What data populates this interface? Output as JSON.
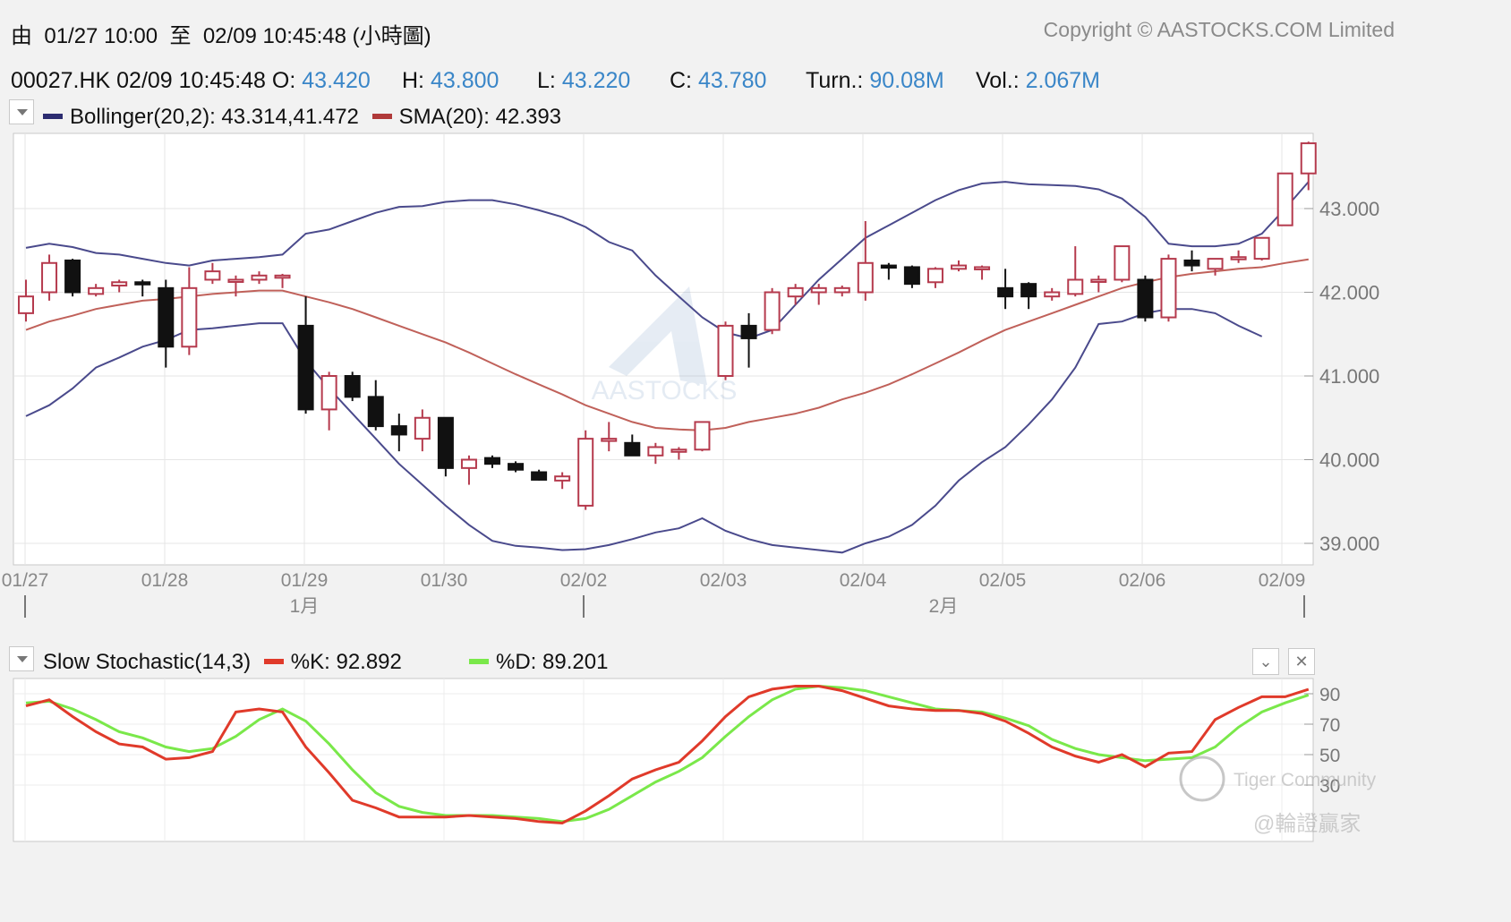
{
  "header": {
    "from_label": "由",
    "from_date": "01/27 10:00",
    "to_label": "至",
    "to_date": "02/09 10:45:48",
    "interval": "(小時圖)",
    "copyright": "Copyright © AASTOCKS.COM Limited"
  },
  "quote": {
    "symbol_time": "00027.HK  02/09 10:45:48",
    "open_label": "O:",
    "open": "43.420",
    "high_label": "H:",
    "high": "43.800",
    "low_label": "L:",
    "low": "43.220",
    "close_label": "C:",
    "close": "43.780",
    "turn_label": "Turn.:",
    "turn": "90.08M",
    "vol_label": "Vol.:",
    "vol": "2.067M"
  },
  "legend": {
    "bollinger": "Bollinger(20,2): 43.314,41.472",
    "sma": "SMA(20): 42.393",
    "stoch": "Slow Stochastic(14,3)",
    "k": "%K: 92.892",
    "d": "%D: 89.201"
  },
  "watermarks": {
    "aastocks": "AASTOCKS",
    "tiger": "Tiger Community",
    "wlwj": "@輪證贏家"
  },
  "colors": {
    "bollinger": "#4a4a8c",
    "sma": "#c0615a",
    "up_candle": "#b53a4d",
    "down_candle": "#111111",
    "stoch_k": "#e03a2a",
    "stoch_d": "#7ae84a",
    "value_blue": "#3a86c8"
  },
  "chart_data": [
    {
      "type": "candlestick",
      "title": "00027.HK",
      "y_ticks": [
        "39.000",
        "40.000",
        "41.000",
        "42.000",
        "43.000"
      ],
      "ylim": [
        38.75,
        43.95
      ],
      "x_ticks": [
        "01/27",
        "01/28",
        "01/29",
        "01/30",
        "02/02",
        "02/03",
        "02/04",
        "02/05",
        "02/06",
        "02/09"
      ],
      "month_labels": [
        {
          "label": "1月",
          "at": "01/29"
        },
        {
          "label": "2月",
          "at": "02/04"
        }
      ],
      "bars_per_day": 6,
      "ohlc": [
        [
          41.75,
          42.15,
          41.65,
          41.95
        ],
        [
          42.0,
          42.45,
          41.9,
          42.35
        ],
        [
          42.38,
          42.4,
          41.95,
          42.0
        ],
        [
          41.98,
          42.1,
          41.95,
          42.05
        ],
        [
          42.08,
          42.15,
          42.0,
          42.12
        ],
        [
          42.12,
          42.15,
          41.95,
          42.1
        ],
        [
          42.05,
          42.15,
          41.1,
          41.35
        ],
        [
          41.35,
          42.3,
          41.25,
          42.05
        ],
        [
          42.15,
          42.35,
          42.1,
          42.25
        ],
        [
          42.15,
          42.2,
          41.95,
          42.15
        ],
        [
          42.15,
          42.25,
          42.1,
          42.2
        ],
        [
          42.18,
          42.22,
          42.05,
          42.2
        ],
        [
          41.6,
          41.95,
          40.55,
          40.6
        ],
        [
          40.6,
          41.05,
          40.35,
          41.0
        ],
        [
          41.0,
          41.05,
          40.7,
          40.75
        ],
        [
          40.75,
          40.95,
          40.35,
          40.4
        ],
        [
          40.4,
          40.55,
          40.1,
          40.3
        ],
        [
          40.25,
          40.6,
          40.1,
          40.5
        ],
        [
          40.5,
          40.5,
          39.8,
          39.9
        ],
        [
          39.9,
          40.05,
          39.7,
          40.0
        ],
        [
          40.02,
          40.05,
          39.9,
          39.95
        ],
        [
          39.95,
          39.98,
          39.85,
          39.88
        ],
        [
          39.85,
          39.88,
          39.75,
          39.76
        ],
        [
          39.75,
          39.85,
          39.65,
          39.8
        ],
        [
          39.45,
          40.35,
          39.4,
          40.25
        ],
        [
          40.25,
          40.45,
          40.1,
          40.25
        ],
        [
          40.2,
          40.3,
          40.05,
          40.05
        ],
        [
          40.05,
          40.2,
          39.95,
          40.15
        ],
        [
          40.1,
          40.15,
          40.0,
          40.12
        ],
        [
          40.12,
          40.45,
          40.1,
          40.45
        ],
        [
          41.0,
          41.65,
          40.95,
          41.6
        ],
        [
          41.6,
          41.75,
          41.1,
          41.45
        ],
        [
          41.55,
          42.05,
          41.5,
          42.0
        ],
        [
          41.95,
          42.1,
          41.85,
          42.05
        ],
        [
          42.0,
          42.1,
          41.85,
          42.05
        ],
        [
          42.0,
          42.08,
          41.95,
          42.05
        ],
        [
          42.0,
          42.85,
          41.9,
          42.35
        ],
        [
          42.32,
          42.35,
          42.15,
          42.3
        ],
        [
          42.3,
          42.32,
          42.05,
          42.1
        ],
        [
          42.12,
          42.3,
          42.05,
          42.28
        ],
        [
          42.28,
          42.38,
          42.25,
          42.32
        ],
        [
          42.3,
          42.32,
          42.15,
          42.3
        ],
        [
          42.05,
          42.28,
          41.8,
          41.95
        ],
        [
          42.1,
          42.12,
          41.8,
          41.95
        ],
        [
          41.95,
          42.05,
          41.9,
          42.0
        ],
        [
          41.98,
          42.55,
          41.95,
          42.15
        ],
        [
          42.15,
          42.2,
          42.0,
          42.15
        ],
        [
          42.15,
          42.55,
          42.12,
          42.55
        ],
        [
          42.15,
          42.2,
          41.65,
          41.7
        ],
        [
          41.7,
          42.45,
          41.65,
          42.4
        ],
        [
          42.38,
          42.5,
          42.25,
          42.32
        ],
        [
          42.28,
          42.4,
          42.2,
          42.4
        ],
        [
          42.4,
          42.5,
          42.35,
          42.42
        ],
        [
          42.4,
          42.65,
          42.38,
          42.65
        ],
        [
          42.8,
          43.35,
          42.8,
          43.42
        ],
        [
          43.42,
          43.8,
          43.22,
          43.78
        ]
      ],
      "overlays": {
        "bollinger_upper": [
          42.53,
          42.58,
          42.54,
          42.47,
          42.45,
          42.4,
          42.35,
          42.32,
          42.38,
          42.4,
          42.42,
          42.45,
          42.7,
          42.75,
          42.85,
          42.95,
          43.02,
          43.03,
          43.08,
          43.1,
          43.1,
          43.05,
          42.98,
          42.9,
          42.78,
          42.6,
          42.5,
          42.2,
          41.95,
          41.7,
          41.52,
          41.45,
          41.55,
          41.85,
          42.15,
          42.4,
          42.65,
          42.8,
          42.95,
          43.1,
          43.22,
          43.3,
          43.32,
          43.29,
          43.28,
          43.27,
          43.23,
          43.12,
          42.9,
          42.58,
          42.55,
          42.55,
          42.58,
          42.7,
          43.0,
          43.32
        ],
        "bollinger_mid": [
          41.55,
          41.65,
          41.72,
          41.8,
          41.85,
          41.9,
          41.92,
          41.95,
          41.98,
          42.0,
          42.02,
          42.02,
          41.95,
          41.88,
          41.8,
          41.7,
          41.6,
          41.5,
          41.4,
          41.28,
          41.15,
          41.02,
          40.9,
          40.78,
          40.65,
          40.55,
          40.45,
          40.38,
          40.36,
          40.35,
          40.38,
          40.45,
          40.5,
          40.55,
          40.62,
          40.72,
          40.8,
          40.9,
          41.02,
          41.15,
          41.28,
          41.42,
          41.55,
          41.65,
          41.75,
          41.85,
          41.95,
          42.05,
          42.12,
          42.18,
          42.22,
          42.25,
          42.28,
          42.3,
          42.35,
          42.393
        ],
        "bollinger_lower": [
          40.52,
          40.65,
          40.85,
          41.1,
          41.22,
          41.35,
          41.43,
          41.55,
          41.57,
          41.6,
          41.63,
          41.63,
          41.18,
          40.85,
          40.55,
          40.25,
          39.95,
          39.7,
          39.45,
          39.22,
          39.03,
          38.97,
          38.95,
          38.92,
          38.93,
          38.98,
          39.05,
          39.13,
          39.18,
          39.3,
          39.15,
          39.05,
          38.98,
          38.95,
          38.92,
          38.89,
          39.0,
          39.08,
          39.22,
          39.45,
          39.75,
          39.97,
          40.15,
          40.42,
          40.72,
          41.1,
          41.62,
          41.65,
          41.75,
          41.8,
          41.8,
          41.75,
          41.6,
          41.472
        ]
      }
    },
    {
      "type": "line",
      "title": "Slow Stochastic(14,3)",
      "y_ticks": [
        "30",
        "50",
        "70",
        "90"
      ],
      "ylim": [
        0,
        100
      ],
      "series": [
        {
          "name": "%K",
          "values": [
            82,
            86,
            75,
            65,
            57,
            55,
            47,
            48,
            52,
            78,
            80,
            78,
            55,
            38,
            20,
            15,
            9,
            9,
            9,
            10,
            9,
            8,
            6,
            5,
            13,
            23,
            34,
            40,
            45,
            59,
            75,
            88,
            93,
            95,
            95,
            92,
            87,
            82,
            80,
            79,
            79,
            77,
            72,
            64,
            55,
            49,
            45,
            50,
            42,
            51,
            52,
            73,
            81,
            88,
            88,
            92.892
          ]
        },
        {
          "name": "%D",
          "values": [
            84,
            85,
            80,
            73,
            65,
            61,
            55,
            52,
            54,
            62,
            73,
            80,
            72,
            57,
            40,
            25,
            16,
            12,
            10,
            10,
            10,
            9,
            8,
            6,
            8,
            14,
            23,
            32,
            39,
            48,
            62,
            75,
            86,
            93,
            95,
            94,
            92,
            88,
            84,
            80,
            79,
            78,
            74,
            69,
            60,
            54,
            50,
            48,
            46,
            47,
            48,
            55,
            68,
            78,
            84,
            89.201
          ]
        }
      ]
    }
  ]
}
